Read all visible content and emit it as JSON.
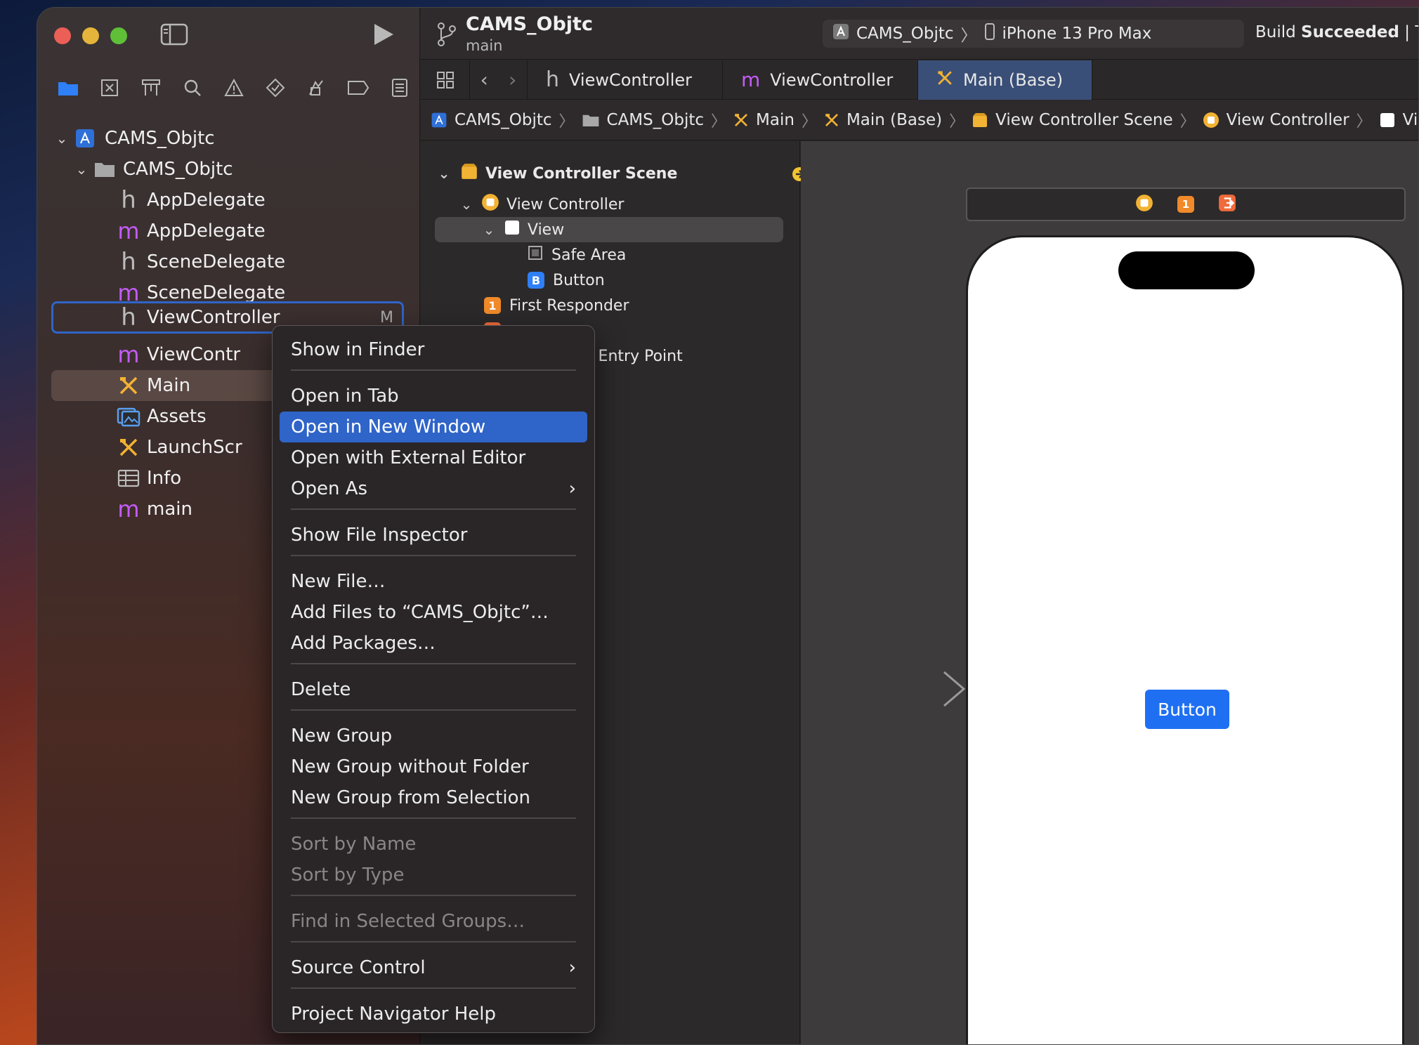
{
  "window": {
    "project": "CAMS_Objtc",
    "branch": "main",
    "scheme": "CAMS_Objtc",
    "device": "iPhone 13 Pro Max",
    "status_prefix": "Build ",
    "status_bold": "Succeeded",
    "status_suffix": " | Today at"
  },
  "sidebar": {
    "tree": [
      {
        "label": "CAMS_Objtc",
        "icon": "project-icon"
      },
      {
        "label": "CAMS_Objtc",
        "icon": "folder-icon"
      },
      {
        "label": "AppDelegate",
        "icon": "header-h-icon",
        "glyph": "h"
      },
      {
        "label": "AppDelegate",
        "icon": "implementation-m-icon",
        "glyph": "m"
      },
      {
        "label": "SceneDelegate",
        "icon": "header-h-icon",
        "glyph": "h"
      },
      {
        "label": "SceneDelegate",
        "icon": "implementation-m-icon",
        "glyph": "m"
      },
      {
        "label": "ViewController",
        "icon": "header-h-icon",
        "glyph": "h",
        "badge": "M"
      },
      {
        "label": "ViewContr",
        "icon": "implementation-m-icon",
        "glyph": "m"
      },
      {
        "label": "Main",
        "icon": "storyboard-icon"
      },
      {
        "label": "Assets",
        "icon": "assets-icon"
      },
      {
        "label": "LaunchScr",
        "icon": "storyboard-icon"
      },
      {
        "label": "Info",
        "icon": "table-icon"
      },
      {
        "label": "main",
        "icon": "implementation-m-icon",
        "glyph": "m"
      }
    ]
  },
  "tabs": [
    {
      "label": "ViewController",
      "glyph": "h"
    },
    {
      "label": "ViewController",
      "glyph": "m"
    },
    {
      "label": "Main (Base)",
      "glyph": "storyboard"
    }
  ],
  "jumpbar": [
    "CAMS_Objtc",
    "CAMS_Objtc",
    "Main",
    "Main (Base)",
    "View Controller Scene",
    "View Controller",
    "View"
  ],
  "outline": {
    "scene": "View Controller Scene",
    "controller": "View Controller",
    "view": "View",
    "safe_area": "Safe Area",
    "button_badge": "B",
    "button": "Button",
    "responder_badge": "1",
    "responder": "First Responder",
    "entry_point": "oard Entry Point"
  },
  "canvas": {
    "button_label": "Button",
    "scene_dock_badge": "1"
  },
  "context_menu": {
    "items": [
      "Show in Finder",
      "Open in Tab",
      "Open in New Window",
      "Open with External Editor",
      "Open As",
      "Show File Inspector",
      "New File…",
      "Add Files to “CAMS_Objtc”…",
      "Add Packages…",
      "Delete",
      "New Group",
      "New Group without Folder",
      "New Group from Selection",
      "Sort by Name",
      "Sort by Type",
      "Find in Selected Groups…",
      "Source Control",
      "Project Navigator Help"
    ]
  },
  "colors": {
    "accent": "#2f64c8",
    "button_blue": "#1f6ff2",
    "storyboard_yellow": "#f2b233"
  }
}
